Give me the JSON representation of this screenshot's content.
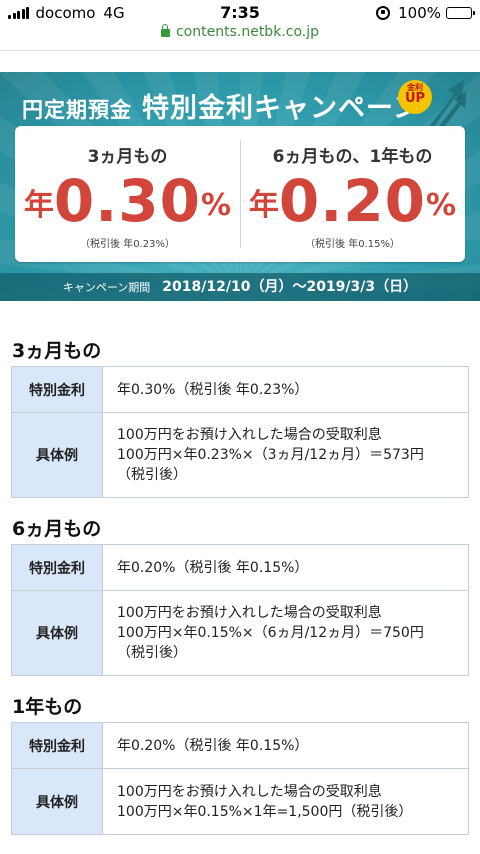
{
  "status_bar": {
    "carrier": "docomo",
    "network": "4G",
    "time": "7:35",
    "battery": "100%",
    "battery_level": 1.0
  },
  "url_bar": {
    "domain": "contents.netbk.co.jp"
  },
  "banner": {
    "title_small": "円定期預金",
    "title_big": "特別金利キャンペーン",
    "badge_top": "金利",
    "badge_main": "UP",
    "rates": [
      {
        "term": "3ヵ月もの",
        "prefix": "年",
        "value": "0.30",
        "unit": "%",
        "tax_note": "（税引後 年0.23%）"
      },
      {
        "term": "6ヵ月もの、1年もの",
        "prefix": "年",
        "value": "0.20",
        "unit": "%",
        "tax_note": "（税引後 年0.15%）"
      }
    ],
    "period_label": "キャンペーン期間",
    "period_value": "2018/12/10（月）〜2019/3/3（日）"
  },
  "sections": [
    {
      "title": "3ヵ月もの",
      "rate_label": "特別金利",
      "rate_value": "年0.30%（税引後 年0.23%）",
      "example_label": "具体例",
      "example_lines": [
        "100万円をお預け入れした場合の受取利息",
        "100万円×年0.23%×（3ヵ月/12ヵ月）＝573円",
        "（税引後）"
      ]
    },
    {
      "title": "6ヵ月もの",
      "rate_label": "特別金利",
      "rate_value": "年0.20%（税引後 年0.15%）",
      "example_label": "具体例",
      "example_lines": [
        "100万円をお預け入れした場合の受取利息",
        "100万円×年0.15%×（6ヵ月/12ヵ月）＝750円",
        "（税引後）"
      ]
    },
    {
      "title": "1年もの",
      "rate_label": "特別金利",
      "rate_value": "年0.20%（税引後 年0.15%）",
      "example_label": "具体例",
      "example_lines": [
        "100万円をお預け入れした場合の受取利息",
        "100万円×年0.15%×1年=1,500円（税引後）"
      ]
    }
  ],
  "colors": {
    "banner_teal": "#2e9aaa",
    "rate_red": "#d2453a",
    "header_cell_blue": "#d9e7f8",
    "url_green": "#3a8a3a",
    "badge_yellow": "#f4c400"
  }
}
